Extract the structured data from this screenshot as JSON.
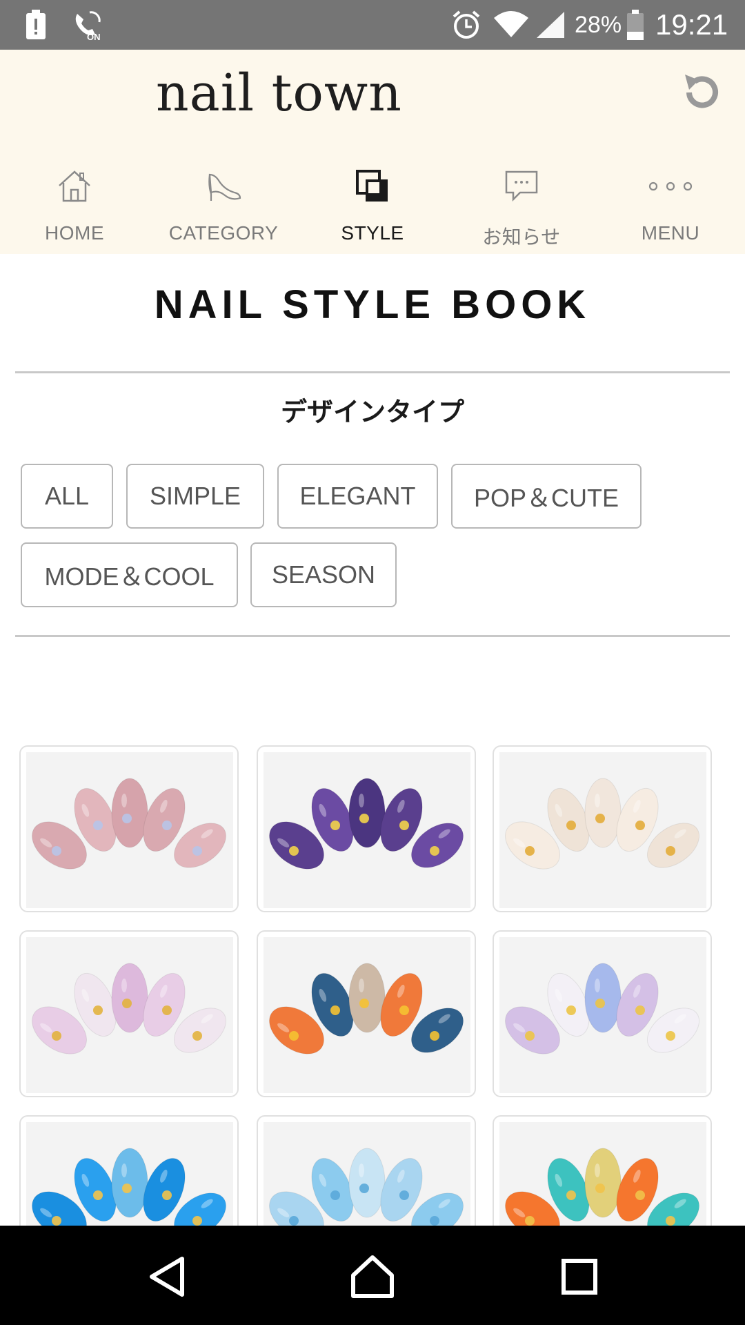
{
  "status_bar": {
    "battery_percent": "28%",
    "time": "19:21",
    "icons": [
      "battery-alert-icon",
      "call-on-icon",
      "alarm-icon",
      "wifi-icon",
      "signal-icon",
      "battery-icon"
    ]
  },
  "header": {
    "logo": "nail town",
    "reload_icon": "reload-icon"
  },
  "tabs": [
    {
      "label": "HOME",
      "icon": "home-icon",
      "active": false
    },
    {
      "label": "CATEGORY",
      "icon": "high-heel-icon",
      "active": false
    },
    {
      "label": "STYLE",
      "icon": "style-layers-icon",
      "active": true
    },
    {
      "label": "お知らせ",
      "icon": "message-icon",
      "active": false
    },
    {
      "label": "MENU",
      "icon": "more-dots-icon",
      "active": false
    }
  ],
  "page": {
    "title": "NAIL STYLE BOOK",
    "section_title": "デザインタイプ"
  },
  "filters": [
    "ALL",
    "SIMPLE",
    "ELEGANT",
    "POP＆CUTE",
    "MODE＆COOL",
    "SEASON"
  ],
  "gallery": [
    {
      "palette": [
        "#d9a9b0",
        "#e2b6bc",
        "#d6a3ab"
      ],
      "accent": "#b8c4e8"
    },
    {
      "palette": [
        "#5a3f8e",
        "#6b4ba3",
        "#4b3580"
      ],
      "accent": "#f2d34a"
    },
    {
      "palette": [
        "#f6ece2",
        "#efe3d7",
        "#f1e6dc"
      ],
      "accent": "#e3ac3a"
    },
    {
      "palette": [
        "#e8cde6",
        "#f0e6ef",
        "#ddb9dc"
      ],
      "accent": "#e2b23e"
    },
    {
      "palette": [
        "#f0793a",
        "#2f5f8a",
        "#cdb9a6"
      ],
      "accent": "#f5c232"
    },
    {
      "palette": [
        "#d4c0e6",
        "#f3f0f6",
        "#a6b9ec"
      ],
      "accent": "#ecc447"
    },
    {
      "palette": [
        "#1a8fe0",
        "#2aa0ee",
        "#6cbcea"
      ],
      "accent": "#f3c34a"
    },
    {
      "palette": [
        "#a9d5f0",
        "#8ccbee",
        "#c8e4f4"
      ],
      "accent": "#5aa9d9"
    },
    {
      "palette": [
        "#f5762e",
        "#3dc2bf",
        "#e2d07a"
      ],
      "accent": "#f1c24a"
    }
  ],
  "nav": [
    "back-icon",
    "home-icon",
    "recents-icon"
  ]
}
